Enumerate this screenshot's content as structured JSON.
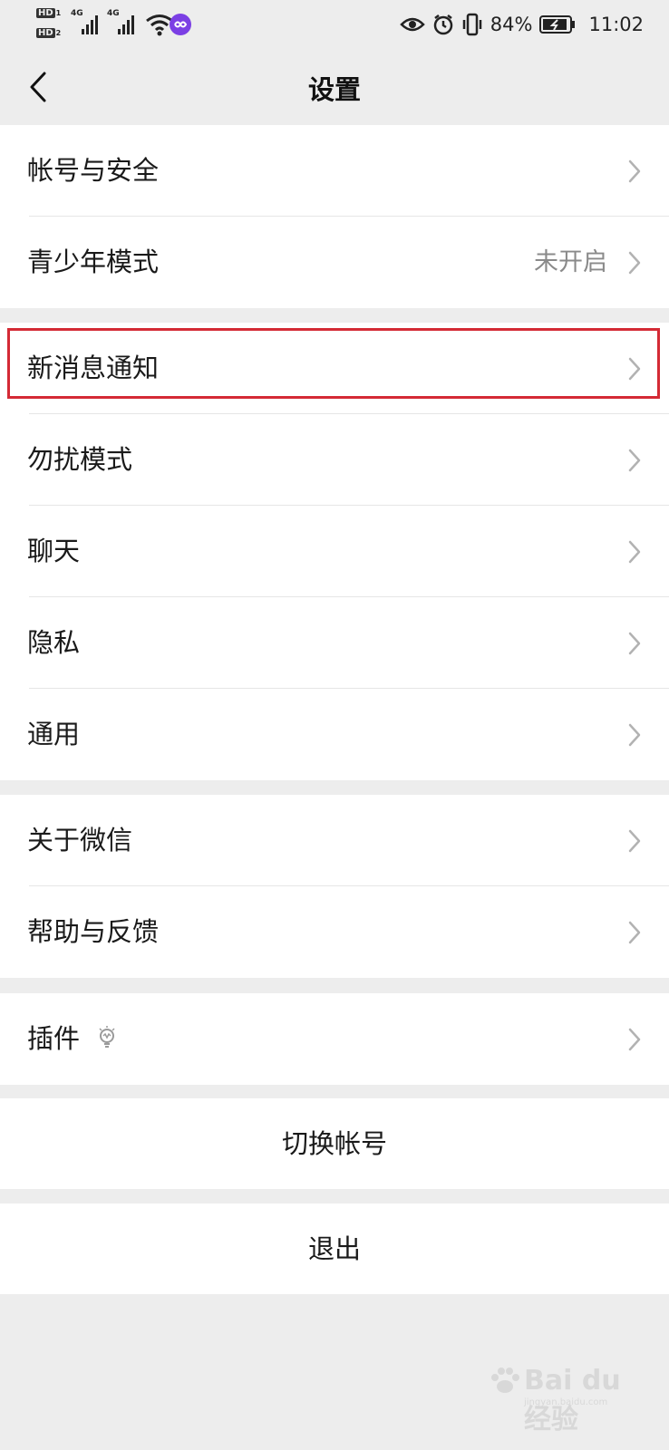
{
  "status_bar": {
    "hd1": "HD",
    "hd1_sub": "1",
    "hd2": "HD",
    "hd2_sub": "2",
    "net1": "4G",
    "net2": "4G",
    "battery_percent": "84%",
    "time": "11:02"
  },
  "nav": {
    "title": "设置"
  },
  "groups": {
    "account": [
      {
        "label": "帐号与安全",
        "value": ""
      },
      {
        "label": "青少年模式",
        "value": "未开启"
      }
    ],
    "settings": [
      {
        "label": "新消息通知"
      },
      {
        "label": "勿扰模式"
      },
      {
        "label": "聊天"
      },
      {
        "label": "隐私"
      },
      {
        "label": "通用"
      }
    ],
    "about": [
      {
        "label": "关于微信"
      },
      {
        "label": "帮助与反馈"
      }
    ],
    "plugins": [
      {
        "label": "插件"
      }
    ]
  },
  "actions": {
    "switch_account": "切换帐号",
    "logout": "退出"
  },
  "watermark": {
    "text": "Bai du 经验",
    "url": "jingyan.baidu.com"
  },
  "colors": {
    "background": "#ededed",
    "highlight": "#d42a35",
    "value_gray": "#8a8a8a"
  }
}
